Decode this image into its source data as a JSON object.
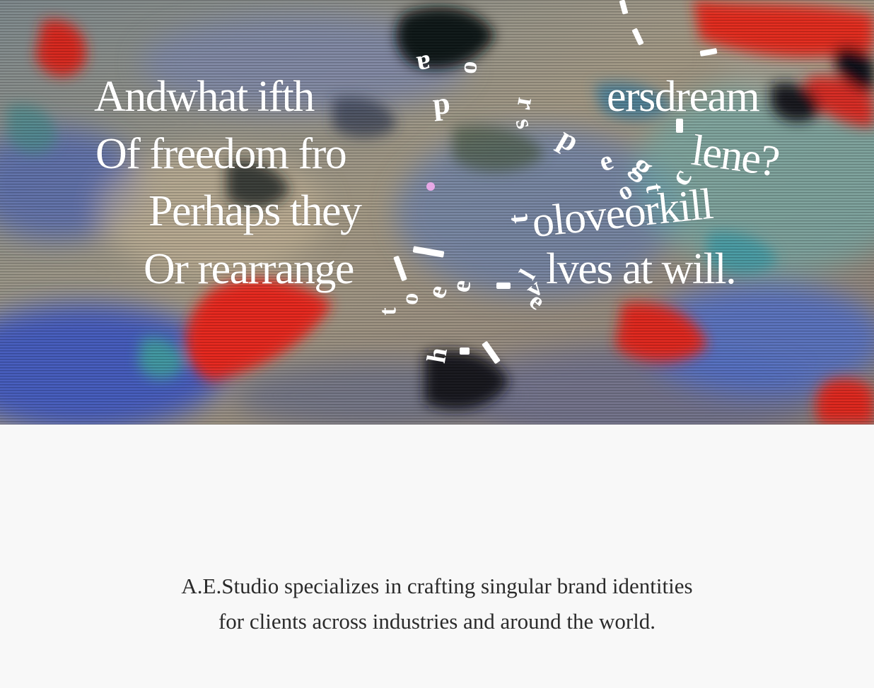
{
  "hero": {
    "poem_lines": [
      "Andwhat ifth",
      "Of freedom fro",
      "Perhaps they",
      "Or rearrange",
      "ersdream",
      "lene?",
      "oloveorkill",
      "lves at will."
    ],
    "scattered_glyphs": [
      "a",
      "p",
      "o",
      "r",
      "s",
      "p",
      "e",
      "g",
      "c",
      "t",
      "o",
      "t",
      "o",
      "t",
      "e",
      "e",
      "l",
      "v",
      "e",
      "h"
    ]
  },
  "about": {
    "tagline_line1": "A.E.Studio specializes in crafting singular brand identities",
    "tagline_line2": "for clients across industries and around the world."
  },
  "colors": {
    "background": "#f8f8f8",
    "text": "#2b2b2b",
    "accent_red": "#e8271d",
    "accent_blue": "#3a56c8",
    "cursor_dot": "#e7a8e6"
  }
}
